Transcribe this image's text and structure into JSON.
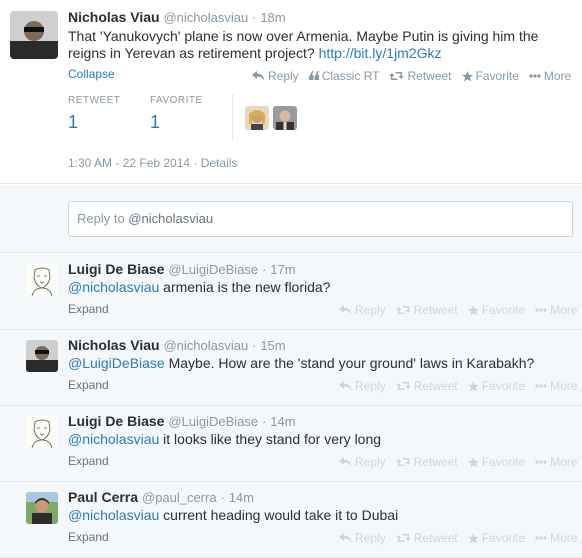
{
  "main_tweet": {
    "name": "Nicholas Viau",
    "handle": "@nicholasviau",
    "time": "18m",
    "text_before": "That 'Yanukovych' plane is now over Armenia. Maybe Putin is giving him the reigns in Yerevan as retirement project? ",
    "link": "http://bit.ly/1jm2Gkz",
    "collapse": "Collapse",
    "actions": {
      "reply": "Reply",
      "classic_rt": "Classic RT",
      "retweet": "Retweet",
      "favorite": "Favorite",
      "more": "More"
    },
    "retweet_label": "RETWEET",
    "retweet_count": "1",
    "favorite_label": "FAVORITE",
    "favorite_count": "1",
    "timestamp": "1:30 AM - 22 Feb 2014",
    "details": "Details"
  },
  "reply_box": {
    "prefix": "Reply to ",
    "mention": "@nicholasviau"
  },
  "replies": [
    {
      "name": "Luigi De Biase",
      "handle": "@LuigiDeBiase",
      "time": "17m",
      "mention": "@nicholasviau",
      "text": " armenia is the new florida?",
      "expand": "Expand"
    },
    {
      "name": "Nicholas Viau",
      "handle": "@nicholasviau",
      "time": "15m",
      "mention": "@LuigiDeBiase",
      "text": " Maybe. How are the 'stand your ground' laws in Karabakh?",
      "expand": "Expand"
    },
    {
      "name": "Luigi De Biase",
      "handle": "@LuigiDeBiase",
      "time": "14m",
      "mention": "@nicholasviau",
      "text": " it looks like they stand for very long",
      "expand": "Expand"
    },
    {
      "name": "Paul Cerra",
      "handle": "@paul_cerra",
      "time": "14m",
      "mention": "@nicholasviau",
      "text": " current heading would take it to Dubai",
      "expand": "Expand"
    }
  ],
  "reply_actions": {
    "reply": "Reply",
    "retweet": "Retweet",
    "favorite": "Favorite",
    "more": "More"
  },
  "colors": {
    "link": "#2b7bb9",
    "muted": "#8899a6",
    "reply_bg": "#f5f8fa"
  }
}
